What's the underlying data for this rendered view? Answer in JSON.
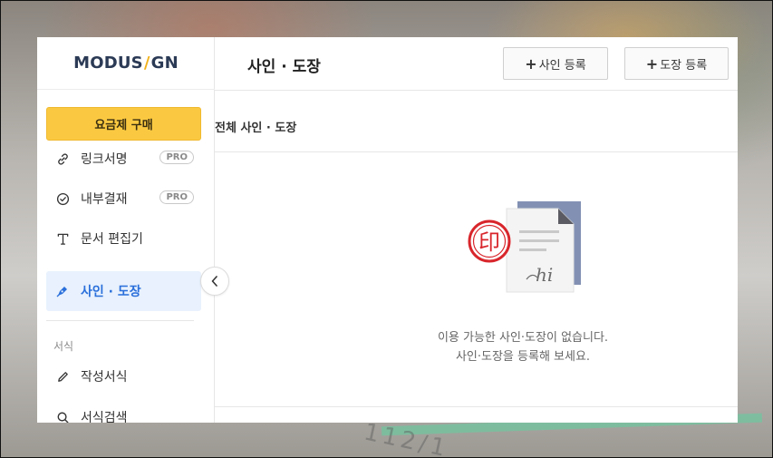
{
  "app": {
    "logo": {
      "left": "MODUS",
      "slash": "/",
      "right": "GN"
    },
    "plan_button": "요금제 구매"
  },
  "sidebar": {
    "items": [
      {
        "label": "링크서명",
        "icon": "link-icon",
        "badge": "PRO",
        "active": false
      },
      {
        "label": "내부결재",
        "icon": "check-circle-icon",
        "badge": "PRO",
        "active": false
      },
      {
        "label": "문서 편집기",
        "icon": "text-icon",
        "badge": "",
        "active": false
      },
      {
        "label": "사인 · 도장",
        "icon": "pen-nib-icon",
        "badge": "",
        "active": true
      }
    ],
    "section_label": "서식",
    "section_items": [
      {
        "label": "작성서식",
        "icon": "pencil-icon"
      },
      {
        "label": "서식검색",
        "icon": "search-icon"
      }
    ]
  },
  "header": {
    "title": "사인 · 도장",
    "buttons": [
      {
        "plus": "+",
        "label": "사인 등록"
      },
      {
        "plus": "+",
        "label": "도장 등록"
      }
    ]
  },
  "subheader": {
    "title": "전체 사인 · 도장"
  },
  "empty_state": {
    "line1": "이용 가능한 사인·도장이 없습니다.",
    "line2": "사인·도장을 등록해 보세요.",
    "signature_text": "hi",
    "stamp_text": "印"
  },
  "colors": {
    "accent": "#2a6fdb",
    "plan_yellow": "#fbc941",
    "stamp_red": "#d8262c",
    "doc_blue": "#8291b3"
  }
}
